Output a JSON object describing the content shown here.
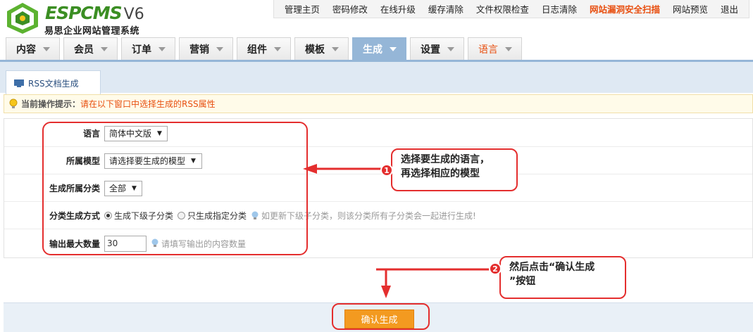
{
  "header": {
    "logo_text": "ESPCMS",
    "logo_version": "V6",
    "logo_subtitle": "易思企业网站管理系统",
    "top_links": [
      {
        "label": "管理主页",
        "warn": false
      },
      {
        "label": "密码修改",
        "warn": false
      },
      {
        "label": "在线升级",
        "warn": false
      },
      {
        "label": "缓存清除",
        "warn": false
      },
      {
        "label": "文件权限检查",
        "warn": false
      },
      {
        "label": "日志清除",
        "warn": false
      },
      {
        "label": "网站漏洞安全扫描",
        "warn": true
      },
      {
        "label": "网站预览",
        "warn": false
      },
      {
        "label": "退出",
        "warn": false
      }
    ],
    "main_tabs": [
      {
        "label": "内容"
      },
      {
        "label": "会员"
      },
      {
        "label": "订单"
      },
      {
        "label": "营销"
      },
      {
        "label": "组件"
      },
      {
        "label": "模板"
      },
      {
        "label": "生成"
      },
      {
        "label": "设置"
      },
      {
        "label": "语言"
      }
    ],
    "active_tab": "生成"
  },
  "subtab": {
    "label": "RSS文档生成"
  },
  "hint": {
    "label": "当前操作提示：",
    "text": "请在以下窗口中选择生成的RSS属性"
  },
  "form": {
    "language": {
      "label": "语言",
      "value": "简体中文版"
    },
    "model": {
      "label": "所属模型",
      "value": "请选择要生成的模型"
    },
    "category": {
      "label": "生成所属分类",
      "value": "全部"
    },
    "mode": {
      "label": "分类生成方式",
      "option_sub": "生成下级子分类",
      "option_only": "只生成指定分类",
      "selected": "option_sub",
      "tip": "如更新下级子分类，则该分类所有子分类会一起进行生成!"
    },
    "max": {
      "label": "输出最大数量",
      "value": "30",
      "tip": "请填写输出的内容数量"
    }
  },
  "footer": {
    "confirm_label": "确认生成"
  },
  "annotations": {
    "callout1_badge": "1",
    "callout1_line1": "选择要生成的语言，",
    "callout1_line2": "再选择相应的模型",
    "callout2_badge": "2",
    "callout2_line1": "然后点击“确认生成",
    "callout2_line2": "”按钮"
  },
  "colors": {
    "accent": "#95b6d7",
    "warning_text": "#e84f10",
    "annotation": "#e42e2e",
    "button": "#f39a20"
  }
}
